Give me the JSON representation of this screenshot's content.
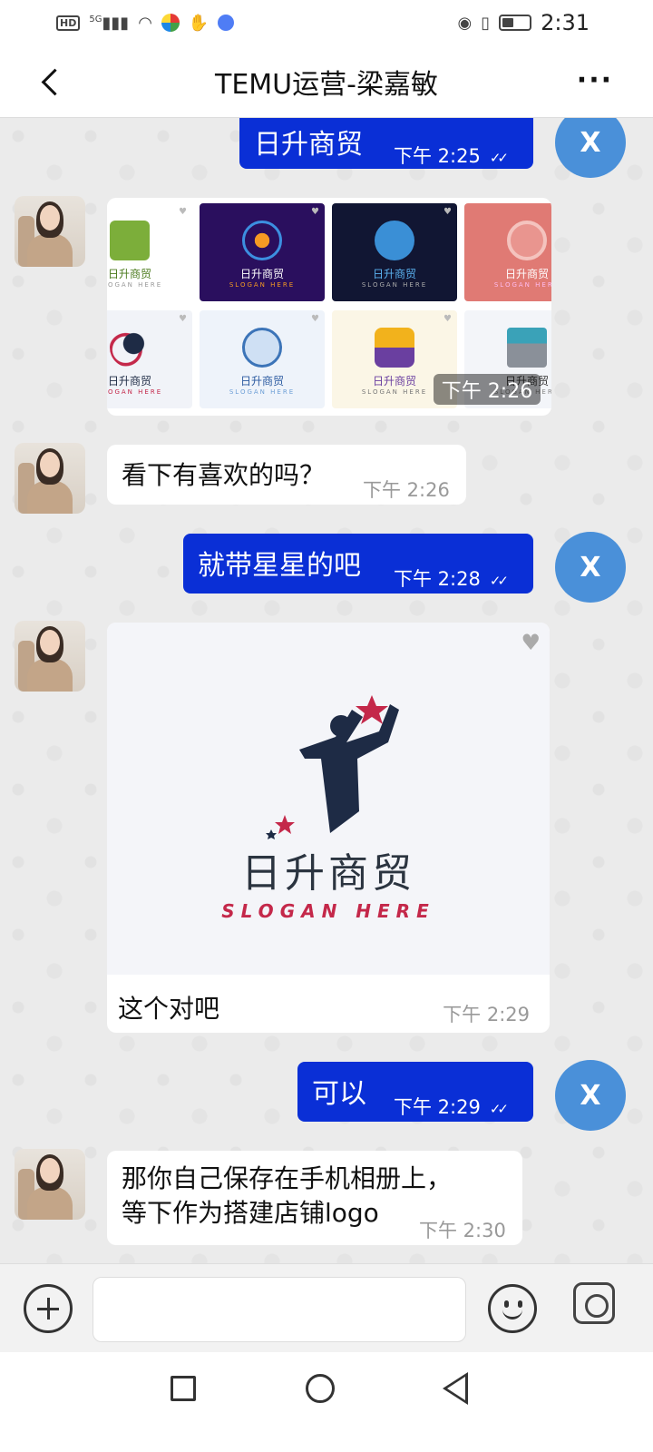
{
  "status_bar": {
    "network_badge": "HD",
    "network_type": "5G",
    "time": "2:31"
  },
  "header": {
    "title": "TEMU运营-梁嘉敏"
  },
  "me_avatar_letter": "X",
  "messages": [
    {
      "id": "m1",
      "direction": "out",
      "text": "日升商贸",
      "time": "下午 2:25",
      "read": true
    },
    {
      "id": "m2",
      "direction": "in",
      "type": "image-grid",
      "time": "下午 2:26",
      "tiles": [
        {
          "brand": "日升商贸",
          "slogan": "SLOGAN HERE",
          "theme": "store",
          "bg": "#ffffff"
        },
        {
          "brand": "日升商贸",
          "slogan": "SLOGAN HERE",
          "theme": "arrow",
          "bg": "#2a0f5e"
        },
        {
          "brand": "日升商贸",
          "slogan": "SLOGAN HERE",
          "theme": "runner",
          "bg": "#111633"
        },
        {
          "brand": "日升商贸",
          "slogan": "SLOGAN HERE",
          "theme": "circle",
          "bg": "#e07a74"
        },
        {
          "brand": "日升商贸",
          "slogan": "SLOGAN HERE",
          "theme": "star",
          "bg": "#f1f3f8"
        },
        {
          "brand": "日升商贸",
          "slogan": "SLOGAN HERE",
          "theme": "bag",
          "bg": "#eef3fa"
        },
        {
          "brand": "日升商贸",
          "slogan": "SLOGAN HERE",
          "theme": "basket",
          "bg": "#fbf6e6"
        },
        {
          "brand": "日升商贸",
          "slogan": "SLOGAN HERE",
          "theme": "shopfront",
          "bg": "#f3f5f9"
        }
      ]
    },
    {
      "id": "m3",
      "direction": "in",
      "text": "看下有喜欢的吗？",
      "time": "下午 2:26"
    },
    {
      "id": "m4",
      "direction": "out",
      "text": "就带星星的吧",
      "time": "下午 2:28",
      "read": true
    },
    {
      "id": "m5",
      "direction": "in",
      "type": "image-caption",
      "brand": "日升商贸",
      "slogan": "SLOGAN HERE",
      "caption": "这个对吧",
      "time": "下午 2:29"
    },
    {
      "id": "m6",
      "direction": "out",
      "text": "可以",
      "time": "下午 2:29",
      "read": true
    },
    {
      "id": "m7",
      "direction": "in",
      "text_line1": "那你自己保存在手机相册上，",
      "text_line2": "等下作为搭建店铺logo",
      "time": "下午 2:30"
    }
  ],
  "input_bar": {
    "placeholder": "",
    "icons": [
      "add-circle-icon",
      "emoji-icon",
      "instagram-icon"
    ]
  },
  "colors": {
    "outgoing_bubble": "#0a2fd6",
    "my_avatar": "#4a90d9",
    "accent_red": "#c4284a",
    "navy": "#1e2b45"
  }
}
